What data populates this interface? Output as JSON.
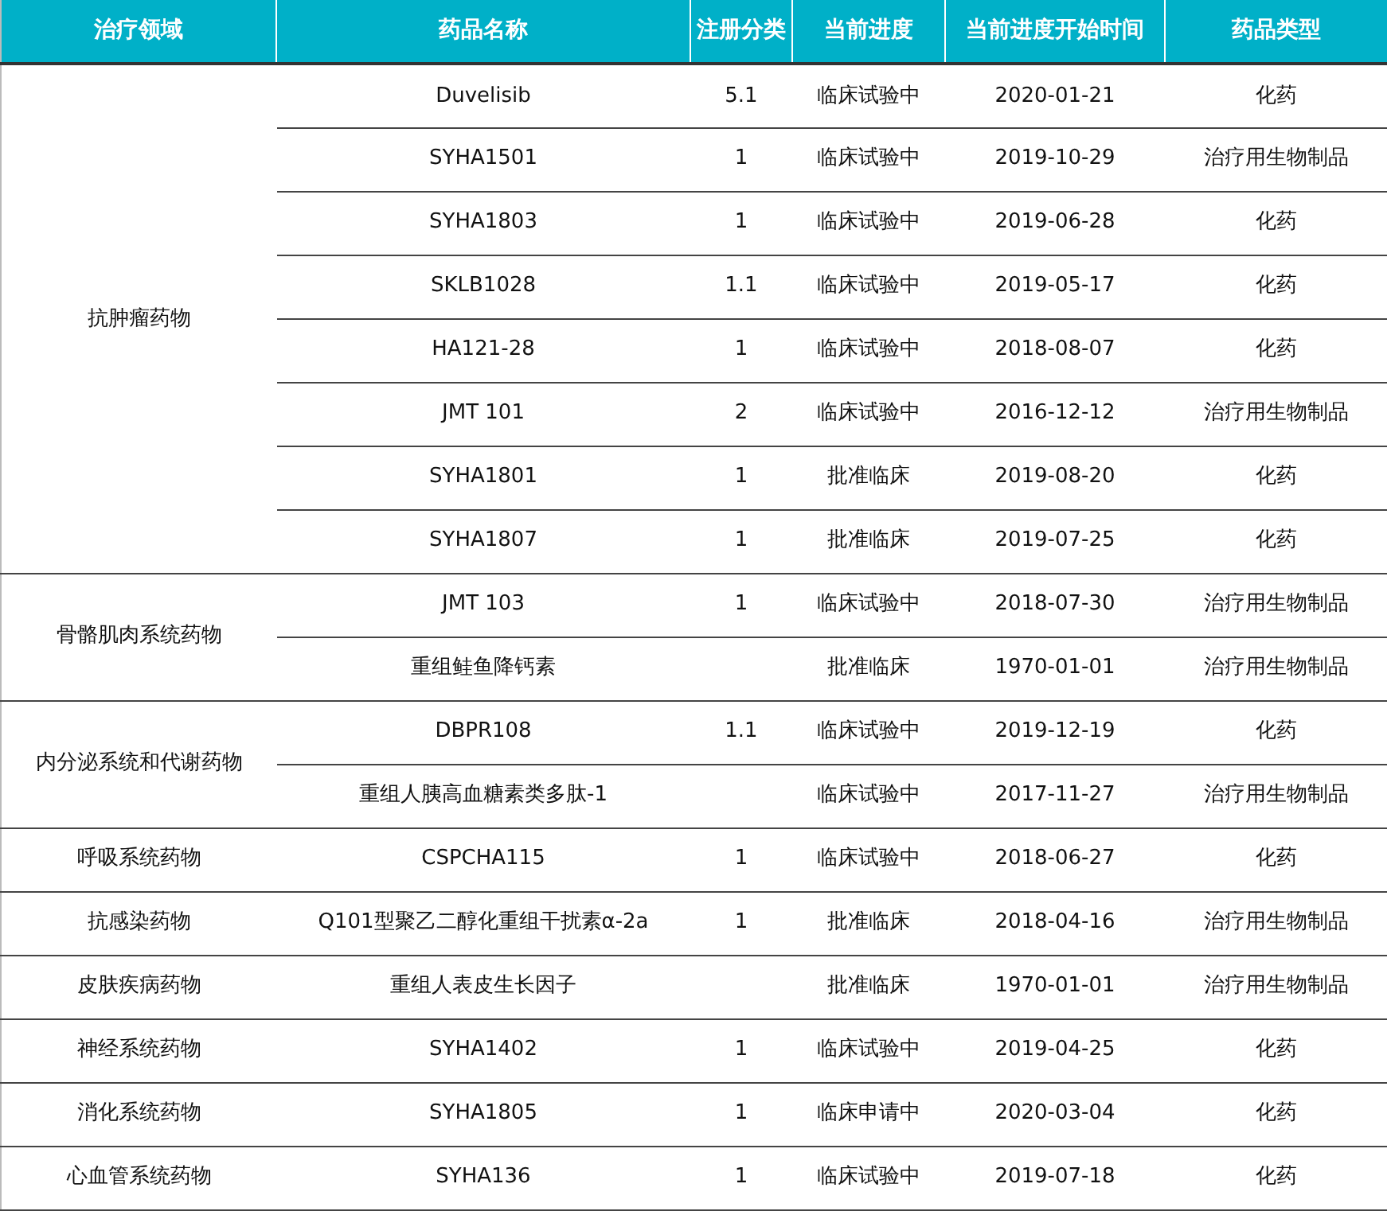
{
  "table": {
    "columns": [
      "治疗领域",
      "药品名称",
      "注册分类",
      "当前进度",
      "当前进度开始时间",
      "药品类型"
    ],
    "groups": [
      {
        "area": "抗肿瘤药物",
        "drugs": [
          {
            "name": "Duvelisib",
            "reg_class": "5.1",
            "progress": "临床试验中",
            "start_date": "2020-01-21",
            "type": "化药"
          },
          {
            "name": "SYHA1501",
            "reg_class": "1",
            "progress": "临床试验中",
            "start_date": "2019-10-29",
            "type": "治疗用生物制品"
          },
          {
            "name": "SYHA1803",
            "reg_class": "1",
            "progress": "临床试验中",
            "start_date": "2019-06-28",
            "type": "化药"
          },
          {
            "name": "SKLB1028",
            "reg_class": "1.1",
            "progress": "临床试验中",
            "start_date": "2019-05-17",
            "type": "化药"
          },
          {
            "name": "HA121-28",
            "reg_class": "1",
            "progress": "临床试验中",
            "start_date": "2018-08-07",
            "type": "化药"
          },
          {
            "name": "JMT 101",
            "reg_class": "2",
            "progress": "临床试验中",
            "start_date": "2016-12-12",
            "type": "治疗用生物制品"
          },
          {
            "name": "SYHA1801",
            "reg_class": "1",
            "progress": "批准临床",
            "start_date": "2019-08-20",
            "type": "化药"
          },
          {
            "name": "SYHA1807",
            "reg_class": "1",
            "progress": "批准临床",
            "start_date": "2019-07-25",
            "type": "化药"
          }
        ]
      },
      {
        "area": "骨骼肌肉系统药物",
        "drugs": [
          {
            "name": "JMT 103",
            "reg_class": "1",
            "progress": "临床试验中",
            "start_date": "2018-07-30",
            "type": "治疗用生物制品"
          },
          {
            "name": "重组鲑鱼降钙素",
            "progress": "批准临床",
            "start_date": "1970-01-01",
            "type": "治疗用生物制品"
          }
        ]
      },
      {
        "area": "内分泌系统和代谢药物",
        "drugs": [
          {
            "name": "DBPR108",
            "reg_class": "1.1",
            "progress": "临床试验中",
            "start_date": "2019-12-19",
            "type": "化药"
          },
          {
            "name": "重组人胰高血糖素类多肽-1",
            "progress": "临床试验中",
            "start_date": "2017-11-27",
            "type": "治疗用生物制品"
          }
        ]
      },
      {
        "area": "呼吸系统药物",
        "drugs": [
          {
            "name": "CSPCHA115",
            "reg_class": "1",
            "progress": "临床试验中",
            "start_date": "2018-06-27",
            "type": "化药"
          }
        ]
      },
      {
        "area": "抗感染药物",
        "drugs": [
          {
            "name": "Q101型聚乙二醇化重组干扰素α-2a",
            "reg_class": "1",
            "progress": "批准临床",
            "start_date": "2018-04-16",
            "type": "治疗用生物制品"
          }
        ]
      },
      {
        "area": "皮肤疾病药物",
        "drugs": [
          {
            "name": "重组人表皮生长因子",
            "progress": "批准临床",
            "start_date": "1970-01-01",
            "type": "治疗用生物制品"
          }
        ]
      },
      {
        "area": "神经系统药物",
        "drugs": [
          {
            "name": "SYHA1402",
            "reg_class": "1",
            "progress": "临床试验中",
            "start_date": "2019-04-25",
            "type": "化药"
          }
        ]
      },
      {
        "area": "消化系统药物",
        "drugs": [
          {
            "name": "SYHA1805",
            "reg_class": "1",
            "progress": "临床申请中",
            "start_date": "2020-03-04",
            "type": "化药"
          }
        ]
      },
      {
        "area": "心血管系统药物",
        "drugs": [
          {
            "name": "SYHA136",
            "reg_class": "1",
            "progress": "临床试验中",
            "start_date": "2019-07-18",
            "type": "化药"
          }
        ]
      }
    ]
  }
}
